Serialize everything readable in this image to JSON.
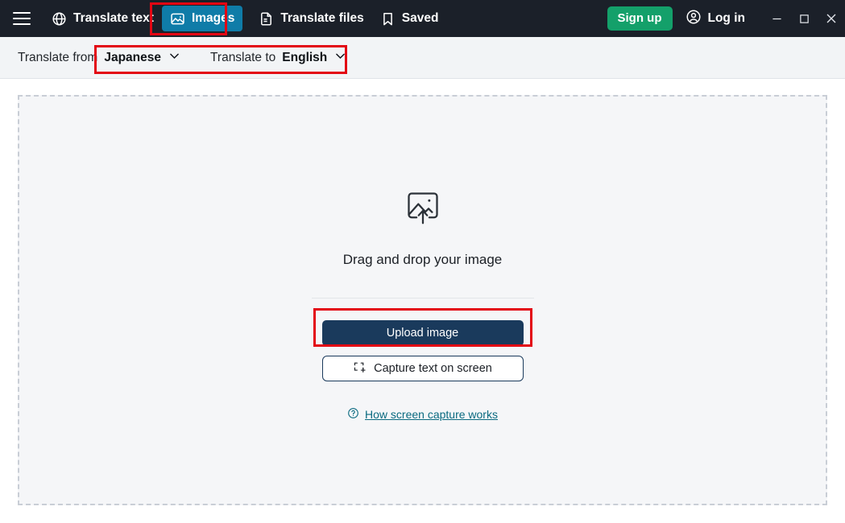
{
  "titlebar": {
    "menu_icon": "hamburger-menu-icon",
    "nav": [
      {
        "id": "translate-text",
        "label": "Translate text",
        "icon": "globe-icon",
        "active": false
      },
      {
        "id": "images",
        "label": "Images",
        "icon": "image-icon",
        "active": true
      },
      {
        "id": "translate-files",
        "label": "Translate files",
        "icon": "document-icon",
        "active": false
      },
      {
        "id": "saved",
        "label": "Saved",
        "icon": "bookmark-icon",
        "active": false
      }
    ],
    "signup_label": "Sign up",
    "login_label": "Log in",
    "login_icon": "user-circle-icon",
    "window_controls": {
      "minimize": "minimize-icon",
      "maximize": "maximize-icon",
      "close": "close-icon"
    },
    "bg_color": "#1b2029",
    "active_tab_color": "#0f7ca8",
    "signup_color": "#14a06a"
  },
  "langbar": {
    "from_label": "Translate from",
    "from_value": "Japanese",
    "to_label": "Translate to",
    "to_value": "English",
    "chevron_icon": "chevron-down-icon",
    "bg_color": "#f2f4f6"
  },
  "dropzone": {
    "icon": "image-upload-icon",
    "title": "Drag and drop your image",
    "upload_button_label": "Upload image",
    "capture_button_label": "Capture text on screen",
    "capture_icon": "screen-capture-icon",
    "help_link_label": "How screen capture works",
    "help_icon": "question-circle-icon",
    "upload_button_color": "#1a3a5c",
    "help_link_color": "#0a6a80",
    "bg_color": "#f5f6f8",
    "border_style": "dashed"
  },
  "annotations": {
    "color": "#e30613",
    "boxes": [
      {
        "id": "annot-images",
        "target": "images-tab"
      },
      {
        "id": "annot-lang",
        "target": "language-selectors"
      },
      {
        "id": "annot-upload",
        "target": "upload-image-button"
      }
    ]
  }
}
